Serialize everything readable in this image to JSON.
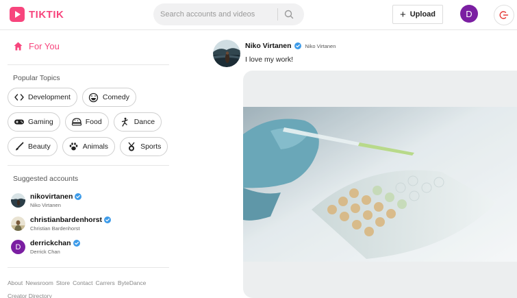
{
  "app": {
    "logo_text": "TIKTIK"
  },
  "search": {
    "placeholder": "Search accounts and videos"
  },
  "header": {
    "upload_label": "Upload",
    "user_initial": "D"
  },
  "sidebar": {
    "for_you_label": "For You",
    "popular_topics_title": "Popular Topics",
    "topics": [
      {
        "label": "Development",
        "icon": "code-icon"
      },
      {
        "label": "Comedy",
        "icon": "laugh-emoji-icon"
      },
      {
        "label": "Gaming",
        "icon": "gamepad-icon"
      },
      {
        "label": "Food",
        "icon": "food-icon"
      },
      {
        "label": "Dance",
        "icon": "dance-icon"
      },
      {
        "label": "Beauty",
        "icon": "brush-icon"
      },
      {
        "label": "Animals",
        "icon": "paw-icon"
      },
      {
        "label": "Sports",
        "icon": "medal-icon"
      }
    ],
    "suggested_title": "Suggested accounts",
    "accounts": [
      {
        "username": "nikovirtanen",
        "display_name": "Niko Virtanen"
      },
      {
        "username": "christianbardenhorst",
        "display_name": "Christian Bardenhorst"
      },
      {
        "username": "derrickchan",
        "display_name": "Derrick Chan",
        "initial": "D"
      }
    ],
    "footer_links": [
      "About",
      "Newsroom",
      "Store",
      "Contact",
      "Carrers",
      "ByteDance"
    ],
    "creator_directory": "Creator Directory"
  },
  "post": {
    "author_name": "Niko Virtanen",
    "author_handle": "Niko Virtanen",
    "caption": "I love my work!"
  },
  "colors": {
    "brand": "#f7457d",
    "verified": "#3d9be9",
    "avatar_purple": "#7b1fa2"
  }
}
